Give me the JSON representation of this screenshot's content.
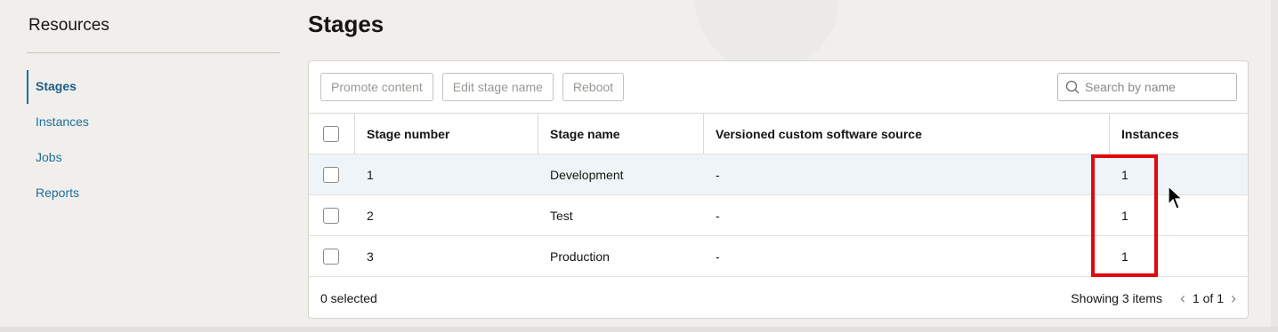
{
  "sidebar": {
    "title": "Resources",
    "items": [
      {
        "label": "Stages",
        "active": true
      },
      {
        "label": "Instances"
      },
      {
        "label": "Jobs"
      },
      {
        "label": "Reports"
      }
    ]
  },
  "main": {
    "title": "Stages",
    "toolbar": {
      "promote_label": "Promote content",
      "edit_label": "Edit stage name",
      "reboot_label": "Reboot"
    },
    "search": {
      "placeholder": "Search by name",
      "icon": "search-icon"
    },
    "table": {
      "columns": [
        "Stage number",
        "Stage name",
        "Versioned custom software source",
        "Instances"
      ],
      "rows": [
        {
          "number": "1",
          "name": "Development",
          "source": "-",
          "instances": "1"
        },
        {
          "number": "2",
          "name": "Test",
          "source": "-",
          "instances": "1"
        },
        {
          "number": "3",
          "name": "Production",
          "source": "-",
          "instances": "1"
        }
      ]
    },
    "footer": {
      "selected": "0 selected",
      "showing": "Showing 3 items",
      "page": "1 of 1"
    }
  },
  "colors": {
    "accent": "#1b6e9e",
    "highlight": "#e2080f"
  }
}
